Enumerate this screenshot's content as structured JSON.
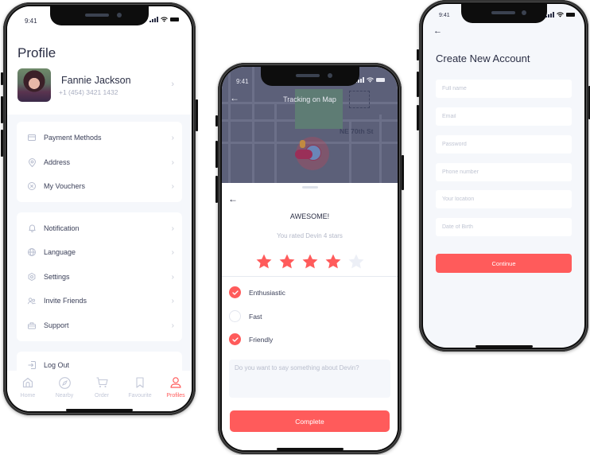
{
  "status_bar": {
    "time": "9:41"
  },
  "profile_screen": {
    "title": "Profile",
    "user": {
      "name": "Fannie Jackson",
      "phone": "+1 (454) 3421 1432"
    },
    "menu_group_1": [
      {
        "label": "Payment Methods",
        "icon": "credit-card-icon"
      },
      {
        "label": "Address",
        "icon": "location-pin-icon"
      },
      {
        "label": "My Vouchers",
        "icon": "voucher-icon"
      }
    ],
    "menu_group_2": [
      {
        "label": "Notification",
        "icon": "bell-icon"
      },
      {
        "label": "Language",
        "icon": "globe-icon"
      },
      {
        "label": "Settings",
        "icon": "gear-icon"
      },
      {
        "label": "Invite Friends",
        "icon": "users-icon"
      },
      {
        "label": "Support",
        "icon": "briefcase-icon"
      }
    ],
    "menu_group_3": [
      {
        "label": "Log Out",
        "icon": "logout-icon"
      }
    ],
    "tabs": [
      {
        "label": "Home",
        "icon": "home-icon",
        "active": false
      },
      {
        "label": "Nearby",
        "icon": "compass-icon",
        "active": false
      },
      {
        "label": "Order",
        "icon": "cart-icon",
        "active": false
      },
      {
        "label": "Favourite",
        "icon": "bookmark-icon",
        "active": false
      },
      {
        "label": "Profiles",
        "icon": "user-icon",
        "active": true
      }
    ]
  },
  "rating_screen": {
    "map_title": "Tracking on Map",
    "street_label": "NE 70th St",
    "heading": "AWESOME!",
    "subheading": "You rated Devin 4 stars",
    "rating": 4,
    "rating_max": 5,
    "options": [
      {
        "label": "Enthusiastic",
        "checked": true
      },
      {
        "label": "Fast",
        "checked": false
      },
      {
        "label": "Friendly",
        "checked": true
      }
    ],
    "comment_placeholder": "Do you want to say something about Devin?",
    "complete_label": "Complete"
  },
  "signup_screen": {
    "title": "Create New Account",
    "fields": [
      {
        "placeholder": "Full name"
      },
      {
        "placeholder": "Email"
      },
      {
        "placeholder": "Password"
      },
      {
        "placeholder": "Phone number"
      },
      {
        "placeholder": "Your location"
      },
      {
        "placeholder": "Date of Birth"
      }
    ],
    "continue_label": "Continue"
  },
  "colors": {
    "accent": "#ff5b5b",
    "text_primary": "#2b2f45",
    "text_muted": "#b3b8c8",
    "screen_bg": "#f5f7fb",
    "star_empty": "#eceff6",
    "map_overlay": "#5c6079"
  }
}
